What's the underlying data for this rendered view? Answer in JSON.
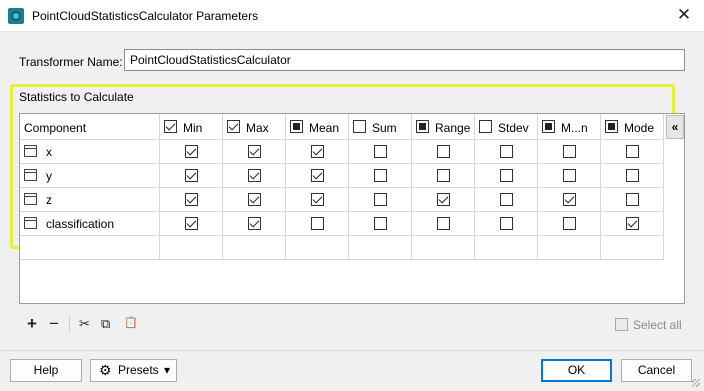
{
  "window": {
    "title": "PointCloudStatisticsCalculator Parameters",
    "close_glyph": "✕",
    "app_icon": "fme-transformer-icon"
  },
  "transformer": {
    "label": "Transformer Name:",
    "value": "PointCloudStatisticsCalculator"
  },
  "stats": {
    "group_label": "Statistics to Calculate",
    "component_header": "Component",
    "columns": [
      {
        "label": "Min",
        "header_state": "checked"
      },
      {
        "label": "Max",
        "header_state": "checked"
      },
      {
        "label": "Mean",
        "header_state": "partial"
      },
      {
        "label": "Sum",
        "header_state": "unchecked"
      },
      {
        "label": "Range",
        "header_state": "partial"
      },
      {
        "label": "Stdev",
        "header_state": "unchecked"
      },
      {
        "label": "M...n",
        "header_state": "partial"
      },
      {
        "label": "Mode",
        "header_state": "partial"
      }
    ],
    "rows": [
      {
        "name": "x",
        "values": [
          true,
          true,
          true,
          false,
          false,
          false,
          false,
          false
        ]
      },
      {
        "name": "y",
        "values": [
          true,
          true,
          true,
          false,
          false,
          false,
          false,
          false
        ]
      },
      {
        "name": "z",
        "values": [
          true,
          true,
          true,
          false,
          true,
          false,
          true,
          false
        ]
      },
      {
        "name": "classification",
        "values": [
          true,
          true,
          false,
          false,
          false,
          false,
          false,
          true
        ]
      }
    ],
    "collapse_glyph": "«"
  },
  "toolbar": {
    "add": "+",
    "remove": "−",
    "cut": "✂",
    "copy": "⧉",
    "paste": "📋",
    "select_all_label": "Select all"
  },
  "buttons": {
    "help": "Help",
    "presets": "Presets",
    "presets_arrow": "▾",
    "ok": "OK",
    "cancel": "Cancel"
  },
  "colors": {
    "highlight": "#e4f03a",
    "ok_border": "#0078d7"
  }
}
